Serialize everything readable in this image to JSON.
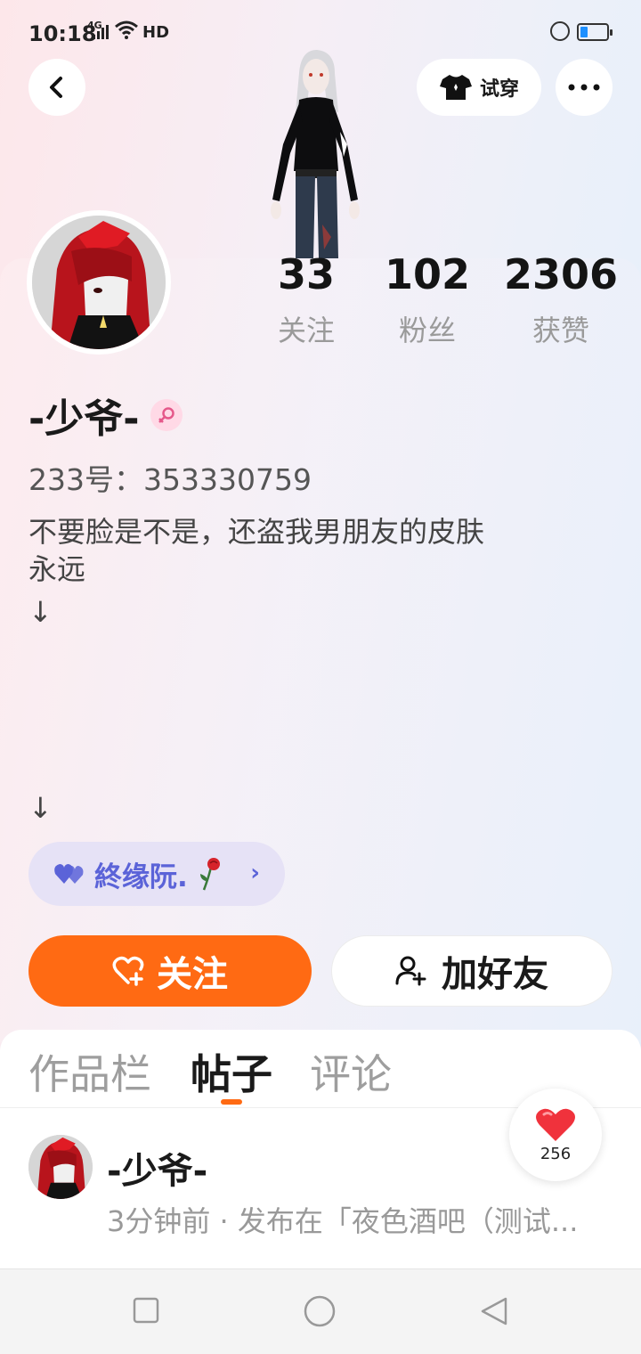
{
  "status_bar": {
    "time": "10:18",
    "network": "4G",
    "hd": "HD"
  },
  "header": {
    "try_on_label": "试穿"
  },
  "profile": {
    "stats": [
      {
        "value": "33",
        "label": "关注"
      },
      {
        "value": "102",
        "label": "粉丝"
      },
      {
        "value": "2306",
        "label": "获赞"
      }
    ],
    "username": "-少爷-",
    "uid": "233号：353330759",
    "bio_line1": "不要脸是不是，还盗我男朋友的皮肤",
    "bio_line2": "永远",
    "arrow": "↓",
    "couple_tag": "終缘阮.",
    "couple_tag_color": "#5b63d8"
  },
  "actions": {
    "follow_label": "关注",
    "add_friend_label": "加好友",
    "accent_color": "#ff6a13"
  },
  "tabs": [
    {
      "label": "作品栏",
      "active": false
    },
    {
      "label": "帖子",
      "active": true
    },
    {
      "label": "评论",
      "active": false
    }
  ],
  "post": {
    "username": "-少爷-",
    "meta": "3分钟前 · 发布在「夜色酒吧（测试..."
  },
  "like_fab": {
    "count": "256"
  }
}
